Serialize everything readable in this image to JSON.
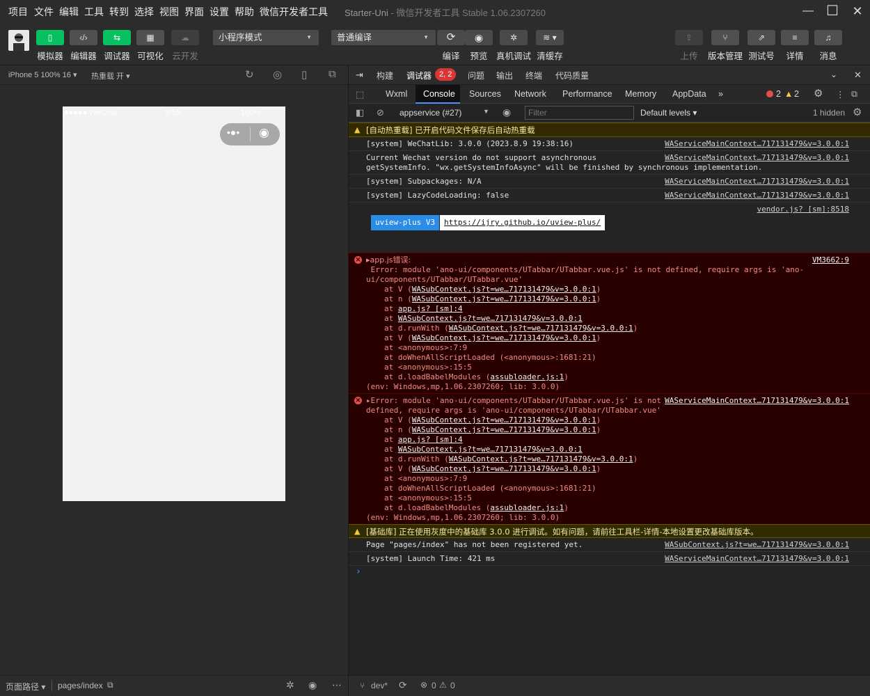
{
  "menubar": {
    "items": [
      "项目",
      "文件",
      "编辑",
      "工具",
      "转到",
      "选择",
      "视图",
      "界面",
      "设置",
      "帮助",
      "微信开发者工具"
    ],
    "project_name": "Starter-Uni",
    "app_title": " - 微信开发者工具 Stable 1.06.2307260"
  },
  "toolbar": {
    "left_buttons": [
      {
        "label": "模拟器",
        "icon": "phone-icon"
      },
      {
        "label": "编辑器",
        "icon": "code-icon"
      },
      {
        "label": "调试器",
        "icon": "sliders-icon"
      },
      {
        "label": "可视化",
        "icon": "layout-icon"
      },
      {
        "label": "云开发",
        "icon": "cloud-icon"
      }
    ],
    "mode_select": "小程序模式",
    "compile_select": "普通编译",
    "mid_buttons": [
      {
        "label": "编译",
        "icon": "refresh-icon"
      },
      {
        "label": "预览",
        "icon": "eye-icon"
      },
      {
        "label": "真机调试",
        "icon": "bug-icon"
      },
      {
        "label": "清缓存",
        "icon": "layers-icon"
      }
    ],
    "right_buttons": [
      {
        "label": "上传",
        "icon": "upload-icon"
      },
      {
        "label": "版本管理",
        "icon": "branch-icon"
      },
      {
        "label": "测试号",
        "icon": "external-icon"
      },
      {
        "label": "详情",
        "icon": "menu-icon"
      },
      {
        "label": "消息",
        "icon": "bell-icon"
      }
    ]
  },
  "simulator": {
    "device": "iPhone 5 100% 16",
    "hot_reload": "热重载 开",
    "status_carrier": "●●●●● WeChat",
    "status_time": "9:55",
    "status_battery": "100%"
  },
  "devtools": {
    "top_tabs": [
      "构建",
      "调试器",
      "问题",
      "输出",
      "终端",
      "代码质量"
    ],
    "debugger_badge": "2, 2",
    "tabs": [
      "Wxml",
      "Console",
      "Sources",
      "Network",
      "Performance",
      "Memory",
      "AppData"
    ],
    "error_count": "2",
    "warn_count": "2",
    "context_select": "appservice (#27)",
    "filter_placeholder": "Filter",
    "levels": "Default levels",
    "hidden": "1 hidden"
  },
  "console": {
    "warn1": "[自动热重载] 已开启代码文件保存后自动热重载",
    "log1": {
      "text": "[system] WeChatLib: 3.0.0 (2023.8.9 19:38:16)",
      "src": "WAServiceMainContext…717131479&v=3.0.0:1"
    },
    "log2": {
      "text1": "Current Wechat version do not support asynchronous",
      "text2": "getSystemInfo. \"wx.getSystemInfoAsync\" will be finished by synchronous implementation.",
      "src": "WAServiceMainContext…717131479&v=3.0.0:1"
    },
    "log3": {
      "text": "[system] Subpackages: N/A",
      "src": "WAServiceMainContext…717131479&v=3.0.0:1"
    },
    "log4": {
      "text": "[system] LazyCodeLoading: false",
      "src": "WAServiceMainContext…717131479&v=3.0.0:1"
    },
    "log5": {
      "src": "vendor.js? [sm]:8518",
      "badge": "uview-plus V3",
      "link": "https://ijry.github.io/uview-plus/"
    },
    "err1": {
      "title": "▸app.js错误:",
      "src": "VM3662:9",
      "msg1": " Error: module 'ano-ui/components/UTabbar/UTabbar.vue.js' is not defined, require args is 'ano-",
      "msg2": "ui/components/UTabbar/UTabbar.vue'",
      "env": "(env: Windows,mp,1.06.2307260; lib: 3.0.0)"
    },
    "err2": {
      "msg1": "▸Error: module 'ano-ui/components/UTabbar/UTabbar.vue.js' is not",
      "msg2": "defined, require args is 'ano-ui/components/UTabbar/UTabbar.vue'",
      "src": "WAServiceMainContext…717131479&v=3.0.0:1",
      "env": "(env: Windows,mp,1.06.2307260; lib: 3.0.0)"
    },
    "stack": [
      {
        "pre": "at V (",
        "link": "WASubContext.js?t=we…717131479&v=3.0.0:1",
        "post": ")"
      },
      {
        "pre": "at n (",
        "link": "WASubContext.js?t=we…717131479&v=3.0.0:1",
        "post": ")"
      },
      {
        "pre": "at ",
        "link": "app.js? [sm]:4",
        "post": ""
      },
      {
        "pre": "at ",
        "link": "WASubContext.js?t=we…717131479&v=3.0.0:1",
        "post": ""
      },
      {
        "pre": "at d.runWith (",
        "link": "WASubContext.js?t=we…717131479&v=3.0.0:1",
        "post": ")"
      },
      {
        "pre": "at V (",
        "link": "WASubContext.js?t=we…717131479&v=3.0.0:1",
        "post": ")"
      },
      {
        "pre": "at <anonymous>:7:9",
        "link": "",
        "post": ""
      },
      {
        "pre": "at doWhenAllScriptLoaded (<anonymous>:1681:21)",
        "link": "",
        "post": ""
      },
      {
        "pre": "at <anonymous>:15:5",
        "link": "",
        "post": ""
      },
      {
        "pre": "at d.loadBabelModules (",
        "link": "assubloader.js:1",
        "post": ")"
      }
    ],
    "warn2": "[基础库] 正在使用灰度中的基础库 3.0.0 进行调试。如有问题，请前往工具栏-详情-本地设置更改基础库版本。",
    "log6": {
      "text": "Page \"pages/index\" has not been registered yet.",
      "src": "WASubContext.js?t=we…717131479&v=3.0.0:1"
    },
    "log7": {
      "text": "[system] Launch Time: 421 ms",
      "src": "WAServiceMainContext…717131479&v=3.0.0:1"
    },
    "prompt": "›"
  },
  "footer": {
    "page_path_label": "页面路径",
    "page_path": "pages/index",
    "branch": "dev*",
    "errors": "0",
    "warnings": "0"
  }
}
